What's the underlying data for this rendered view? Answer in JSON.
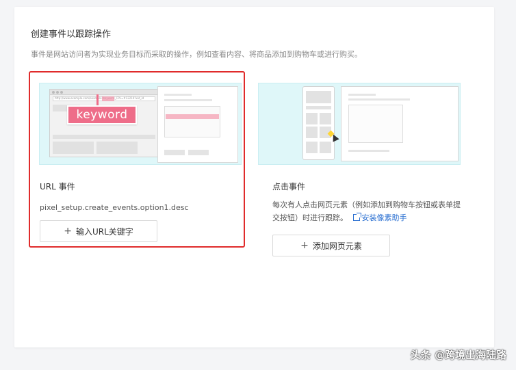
{
  "header": {
    "title": "创建事件以跟踪操作",
    "subtitle": "事件是网站访问者为实现业务目标而采取的操作，例如查看内容、将商品添加到购物车或进行购买。"
  },
  "url_event": {
    "keyword_badge": "keyword",
    "address_text": "http://www.example.com/example?keyword_CPL=#12219?xid_id",
    "label": "URL 事件",
    "description": "pixel_setup.create_events.option1.desc",
    "button_label": "输入URL关键字",
    "accent_color": "#e02b2b"
  },
  "click_event": {
    "label": "点击事件",
    "description_line1": "每次有人点击网页元素（例如添加到购物车按钮或表单提",
    "description_line2": "交按钮）时进行跟踪。",
    "link_label": "安装像素助手",
    "button_label": "添加网页元素",
    "link_color": "#2a6fd1"
  },
  "watermark": "头条 @跨境出海陆路"
}
